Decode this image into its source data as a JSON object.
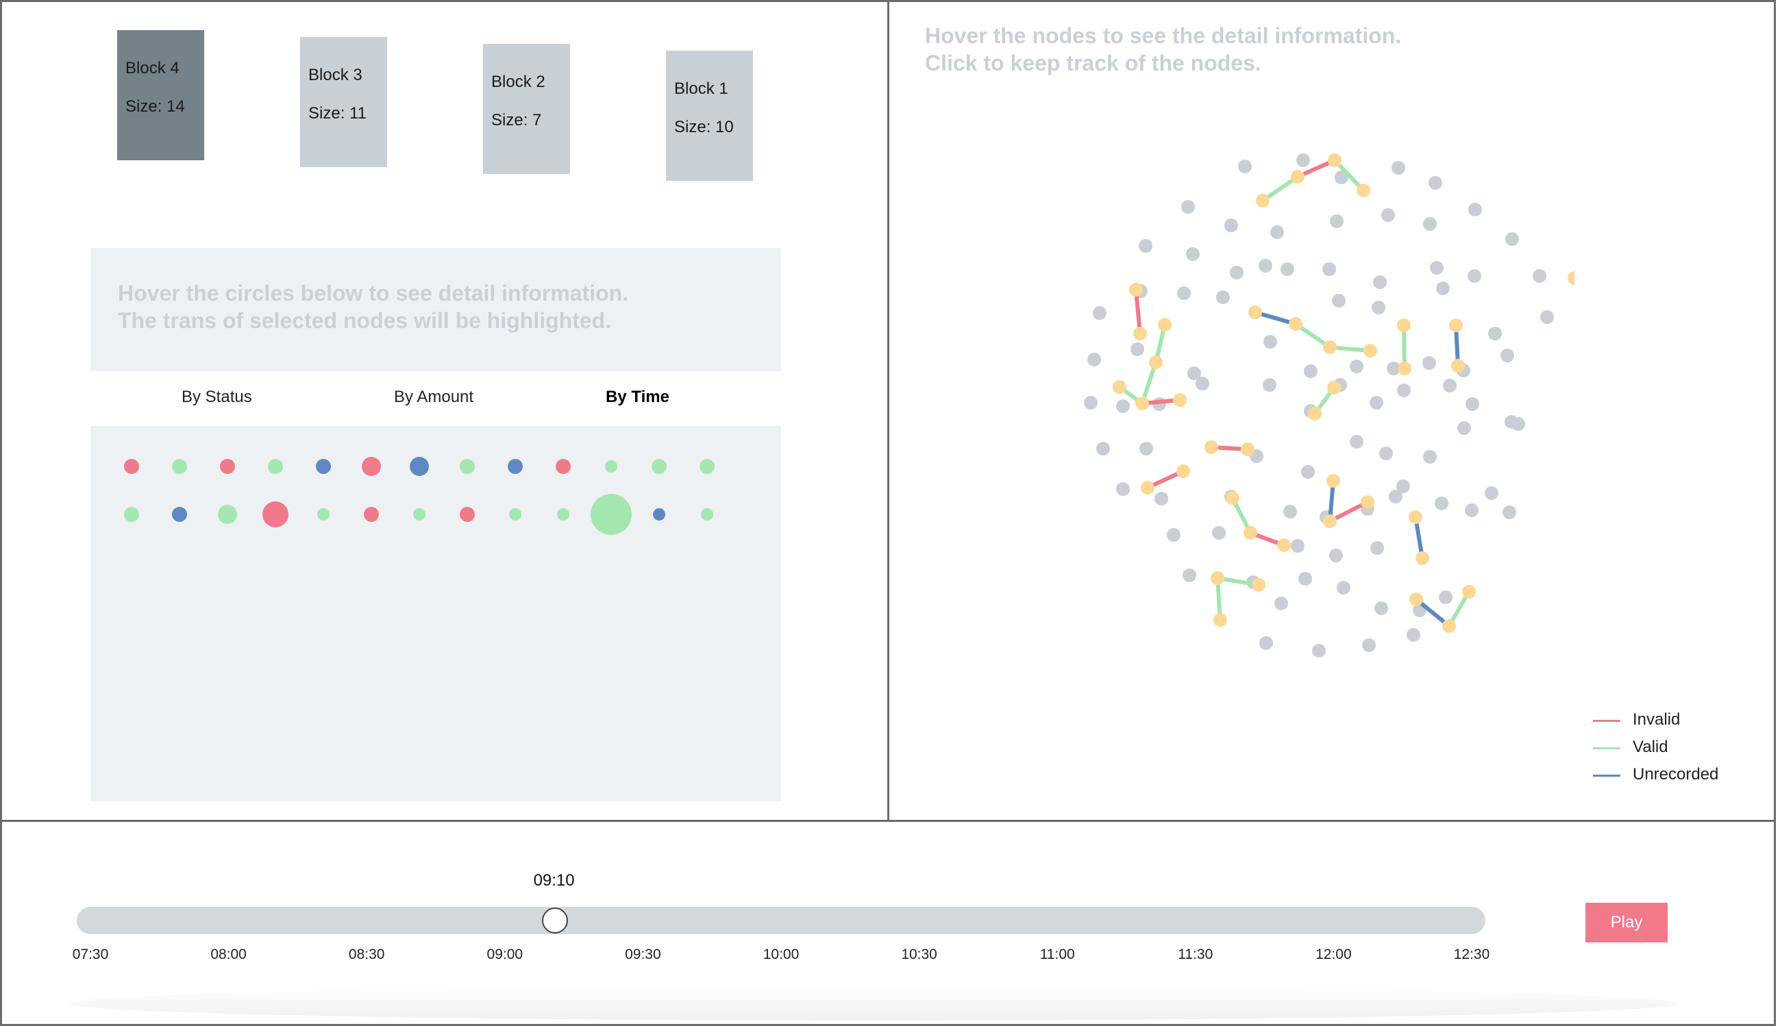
{
  "blocks": [
    {
      "name": "Block 4",
      "size": "Size: 14",
      "active": true
    },
    {
      "name": "Block 3",
      "size": "Size: 11",
      "active": false
    },
    {
      "name": "Block 2",
      "size": "Size: 7",
      "active": false
    },
    {
      "name": "Block 1",
      "size": "Size: 10",
      "active": false
    }
  ],
  "left_hint": "Hover the circles below to see detail information.\nThe trans of selected nodes will be highlighted.",
  "sort_tabs": [
    {
      "label": "By Status",
      "active": false
    },
    {
      "label": "By Amount",
      "active": false
    },
    {
      "label": "By Time",
      "active": true
    }
  ],
  "colors": {
    "invalid": "#f07a8a",
    "valid": "#a3e6b0",
    "unrecorded": "#5e88c2",
    "node": "#c8ced4",
    "selected_node": "#fcd894",
    "block_active": "#758289",
    "block": "#c8d0d6"
  },
  "transactions": [
    [
      {
        "status": "invalid",
        "size": "s"
      },
      {
        "status": "valid",
        "size": "s"
      },
      {
        "status": "invalid",
        "size": "s"
      },
      {
        "status": "valid",
        "size": "s"
      },
      {
        "status": "unrecorded",
        "size": "s"
      },
      {
        "status": "invalid",
        "size": "m"
      },
      {
        "status": "unrecorded",
        "size": "m"
      },
      {
        "status": "valid",
        "size": "s"
      },
      {
        "status": "unrecorded",
        "size": "s"
      },
      {
        "status": "invalid",
        "size": "s"
      },
      {
        "status": "valid",
        "size": "xs"
      },
      {
        "status": "valid",
        "size": "s"
      },
      {
        "status": "valid",
        "size": "s"
      }
    ],
    [
      {
        "status": "valid",
        "size": "s"
      },
      {
        "status": "unrecorded",
        "size": "s"
      },
      {
        "status": "valid",
        "size": "m"
      },
      {
        "status": "invalid",
        "size": "l"
      },
      {
        "status": "valid",
        "size": "xs"
      },
      {
        "status": "invalid",
        "size": "s"
      },
      {
        "status": "valid",
        "size": "xs"
      },
      {
        "status": "invalid",
        "size": "s"
      },
      {
        "status": "valid",
        "size": "xs"
      },
      {
        "status": "valid",
        "size": "xs"
      },
      {
        "status": "valid",
        "size": "xl"
      },
      {
        "status": "unrecorded",
        "size": "xs"
      },
      {
        "status": "valid",
        "size": "xs"
      }
    ]
  ],
  "graph_hint": "Hover the nodes to see the detail information.\nClick to keep track of the nodes.",
  "legend": [
    {
      "label": "Invalid",
      "status": "invalid"
    },
    {
      "label": "Valid",
      "status": "valid"
    },
    {
      "label": "Unrecorded",
      "status": "unrecorded"
    }
  ],
  "slider": {
    "value_label": "09:10",
    "ticks": [
      "07:30",
      "08:00",
      "08:30",
      "09:00",
      "09:30",
      "10:00",
      "10:30",
      "11:00",
      "11:30",
      "12:00",
      "12:30"
    ],
    "position": 0.3361
  },
  "play_label": "Play"
}
